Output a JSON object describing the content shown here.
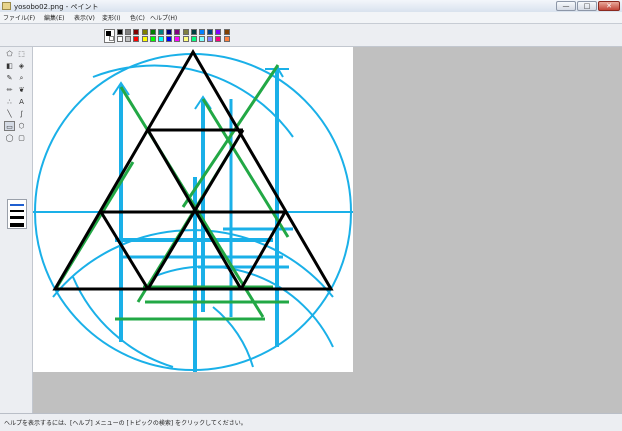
{
  "window": {
    "title": "yosobo02.png - ペイント",
    "minimize_label": "—",
    "maximize_label": "□",
    "close_label": "✕"
  },
  "menu": [
    "ファイル(F)",
    "編集(E)",
    "表示(V)",
    "変形(I)",
    "色(C)",
    "ヘルプ(H)"
  ],
  "palette": {
    "foreground": "#000000",
    "background": "#ffffff",
    "colors": [
      "#000000",
      "#808080",
      "#800000",
      "#808000",
      "#008000",
      "#008080",
      "#000080",
      "#800080",
      "#808040",
      "#004040",
      "#0080ff",
      "#004080",
      "#8000ff",
      "#804000",
      "#ffffff",
      "#c0c0c0",
      "#ff0000",
      "#ffff00",
      "#00ff00",
      "#00ffff",
      "#0000ff",
      "#ff00ff",
      "#ffff80",
      "#00ff80",
      "#80ffff",
      "#8080ff",
      "#ff0080",
      "#ff8040"
    ]
  },
  "tools": [
    {
      "name": "free-select-icon",
      "glyph": "⬠"
    },
    {
      "name": "rect-select-icon",
      "glyph": "⬚"
    },
    {
      "name": "eraser-icon",
      "glyph": "◧"
    },
    {
      "name": "fill-icon",
      "glyph": "◈"
    },
    {
      "name": "color-picker-icon",
      "glyph": "✎"
    },
    {
      "name": "magnifier-icon",
      "glyph": "⌕"
    },
    {
      "name": "pencil-icon",
      "glyph": "✏"
    },
    {
      "name": "brush-icon",
      "glyph": "❦"
    },
    {
      "name": "airbrush-icon",
      "glyph": "∴"
    },
    {
      "name": "text-icon",
      "glyph": "A"
    },
    {
      "name": "line-icon",
      "glyph": "╲"
    },
    {
      "name": "curve-icon",
      "glyph": "∫"
    },
    {
      "name": "rectangle-icon",
      "glyph": "▭"
    },
    {
      "name": "polygon-icon",
      "glyph": "⬡"
    },
    {
      "name": "ellipse-icon",
      "glyph": "◯"
    },
    {
      "name": "rounded-rect-icon",
      "glyph": "▢"
    }
  ],
  "status": {
    "text": "ヘルプを表示するには、[ヘルプ] メニューの [トピックの検索] をクリックしてください。"
  },
  "drawing_colors": {
    "cyan": "#1ab0e8",
    "green": "#22a845",
    "black": "#000000"
  }
}
